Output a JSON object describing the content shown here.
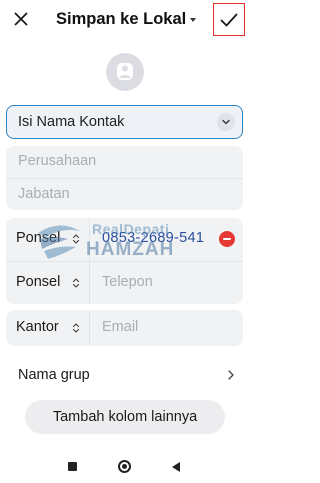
{
  "header": {
    "title": "Simpan ke Lokal",
    "close_icon": "close-icon",
    "confirm_icon": "check-icon"
  },
  "avatar": {
    "icon": "person-icon"
  },
  "name_field": {
    "placeholder": "Isi Nama Kontak",
    "icon": "chevron-down-icon"
  },
  "company": {
    "placeholder": "Perusahaan"
  },
  "job_title": {
    "placeholder": "Jabatan"
  },
  "phones": [
    {
      "type": "Ponsel",
      "value": "0853-2689-541",
      "remove_icon": "remove-icon"
    },
    {
      "type": "Ponsel",
      "placeholder": "Telepon"
    }
  ],
  "email": {
    "type": "Kantor",
    "placeholder": "Email"
  },
  "watermark": {
    "line1": "RealDepati",
    "line2": "HAMZAH"
  },
  "group": {
    "label": "Nama grup",
    "icon": "chevron-right-icon"
  },
  "more_fields_button": "Tambah kolom lainnya",
  "navbar": {
    "recents_icon": "square-icon",
    "home_icon": "home-icon",
    "back_icon": "back-icon"
  },
  "colors": {
    "accent": "#2e86c9",
    "confirm_border": "#e3312e",
    "remove": "#e53935",
    "link_value": "#2a4f9e"
  }
}
